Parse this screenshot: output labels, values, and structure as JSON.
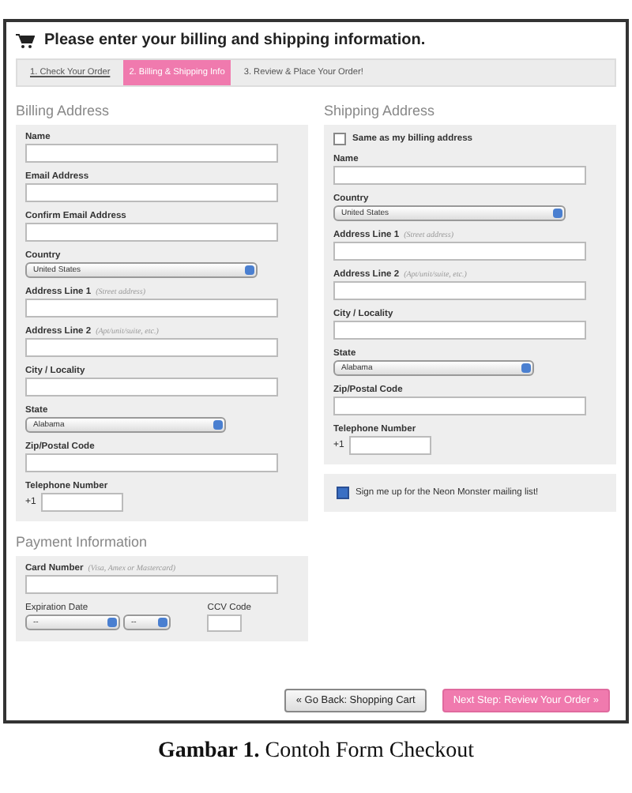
{
  "header": {
    "title": "Please enter your billing and shipping information."
  },
  "steps": [
    {
      "label": "1. Check Your Order",
      "selected": false
    },
    {
      "label": "2. Billing & Shipping Info",
      "selected": true
    },
    {
      "label": "3. Review & Place Your Order!",
      "selected": false
    }
  ],
  "billing": {
    "title": "Billing Address",
    "fields": [
      {
        "kind": "text",
        "label": "Name"
      },
      {
        "kind": "text",
        "label": "Email Address"
      },
      {
        "kind": "text",
        "label": "Confirm Email Address"
      },
      {
        "kind": "select",
        "label": "Country",
        "value": "United States"
      },
      {
        "kind": "text",
        "label": "Address Line 1",
        "hint": "(Street address)"
      },
      {
        "kind": "text",
        "label": "Address Line 2",
        "hint": "(Apt/unit/suite, etc.)"
      },
      {
        "kind": "text",
        "label": "City / Locality"
      },
      {
        "kind": "select",
        "label": "State",
        "value": "Alabama"
      },
      {
        "kind": "text",
        "label": "Zip/Postal Code"
      },
      {
        "kind": "phone",
        "label": "Telephone Number",
        "prefix": "+1"
      }
    ]
  },
  "shipping": {
    "title": "Shipping Address",
    "fields": [
      {
        "kind": "checkbox",
        "label": "Same as my billing address",
        "checked": false
      },
      {
        "kind": "text",
        "label": "Name"
      },
      {
        "kind": "select",
        "label": "Country",
        "value": "United States"
      },
      {
        "kind": "text",
        "label": "Address Line 1",
        "hint": "(Street address)"
      },
      {
        "kind": "text",
        "label": "Address Line 2",
        "hint": "(Apt/unit/suite, etc.)"
      },
      {
        "kind": "text",
        "label": "City / Locality"
      },
      {
        "kind": "select",
        "label": "State",
        "value": "Alabama"
      },
      {
        "kind": "text",
        "label": "Zip/Postal Code"
      },
      {
        "kind": "phone",
        "label": "Telephone Number",
        "prefix": "+1"
      }
    ]
  },
  "mailing_list": {
    "label": "Sign me up for the Neon Monster mailing list!",
    "checked": true
  },
  "payment": {
    "title": "Payment Information",
    "card_label": "Card Number",
    "card_hint": "(Visa, Amex or Mastercard)",
    "expiration_label": "Expiration Date",
    "expiration_selects": [
      "--",
      "--"
    ],
    "ccv_label": "CCV Code"
  },
  "buttons": [
    {
      "label": "« Go Back: Shopping Cart",
      "kind": "secondary"
    },
    {
      "label": "Next Step: Review Your Order »",
      "kind": "primary"
    }
  ],
  "caption": {
    "number": "Gambar 1.",
    "text": "Contoh Form Checkout"
  }
}
